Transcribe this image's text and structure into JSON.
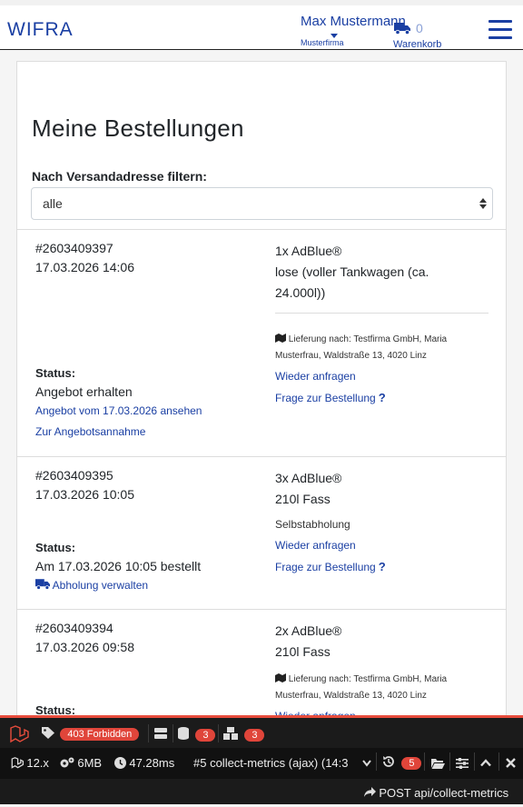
{
  "header": {
    "brand": "WIFRA",
    "user_name": "Max Mustermann",
    "user_company": "Musterfirma",
    "cart_count": "0",
    "cart_label": "Warenkorb"
  },
  "main": {
    "title": "Meine Bestellungen",
    "filter_label": "Nach Versandadresse filtern:",
    "filter_value": "alle"
  },
  "orders": [
    {
      "number": "#2603409397",
      "date": "17.03.2026 14:06",
      "product_line1": "1x AdBlue®",
      "product_line2": "lose (voller Tankwagen (ca.",
      "product_line3": "24.000l))",
      "delivery_line1": "Lieferung nach: Testfirma GmbH, Maria",
      "delivery_line2": "Musterfrau, Waldstraße 13, 4020 Linz",
      "status_label": "Status:",
      "status_text": "Angebot erhalten",
      "link_offer": "Angebot vom 17.03.2026 ansehen",
      "link_accept": "Zur Angebotsannahme",
      "link_reorder": "Wieder anfragen",
      "link_question": "Frage zur Bestellung"
    },
    {
      "number": "#2603409395",
      "date": "17.03.2026 10:05",
      "product_line1": "3x AdBlue®",
      "product_line2": "210l Fass",
      "delivery_text": "Selbstabholung",
      "status_label": "Status:",
      "status_text": "Am 17.03.2026 10:05 bestellt",
      "link_pickup": "Abholung verwalten",
      "link_reorder": "Wieder anfragen",
      "link_question": "Frage zur Bestellung"
    },
    {
      "number": "#2603409394",
      "date": "17.03.2026 09:58",
      "product_line1": "2x AdBlue®",
      "product_line2": "210l Fass",
      "delivery_line1": "Lieferung nach: Testfirma GmbH, Maria",
      "delivery_line2": "Musterfrau, Waldstraße 13, 4020 Linz",
      "status_label": "Status:",
      "link_reorder": "Wieder anfragen"
    }
  ],
  "debugbar": {
    "status_badge": "403 Forbidden",
    "db_count": "3",
    "models_count": "3",
    "php_version": "12.x",
    "memory": "6MB",
    "time": "47.28ms",
    "request": "#5 collect-metrics (ajax) (14:3",
    "history_count": "5",
    "route": "POST api/collect-metrics",
    "accent_color": "#e74c3c"
  }
}
